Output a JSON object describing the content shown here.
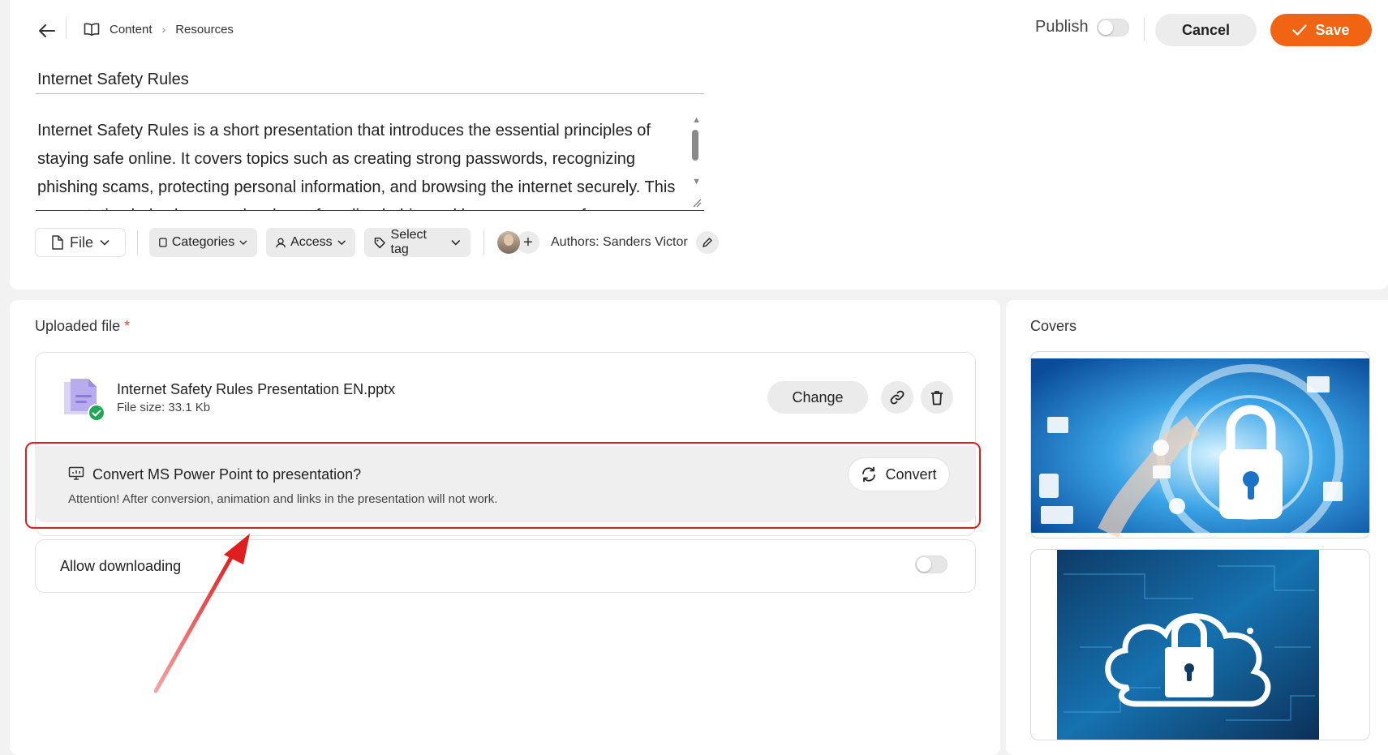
{
  "breadcrumb": {
    "items": [
      "Content",
      "Resources"
    ]
  },
  "header": {
    "publish_label": "Publish",
    "publish_on": false,
    "cancel_label": "Cancel",
    "save_label": "Save"
  },
  "resource": {
    "title": "Internet Safety Rules",
    "description": "Internet Safety Rules is a short presentation that introduces the essential principles of staying safe online. It covers topics such as creating strong passwords, recognizing phishing scams, protecting personal information, and browsing the internet securely. This presentation helps learners develop safe online habits and become aware of common risks."
  },
  "toolbar": {
    "file_label": "File",
    "categories_label": "Categories",
    "access_label": "Access",
    "tag_label": "Select tag",
    "authors_label": "Authors: Sanders Victor"
  },
  "upload": {
    "section_label": "Uploaded file",
    "required_mark": "*",
    "file_name": "Internet Safety Rules Presentation EN.pptx",
    "file_size": "File size: 33.1 Kb",
    "change_label": "Change"
  },
  "convert": {
    "title": "Convert MS Power Point to presentation?",
    "note": "Attention! After conversion, animation and links in the presentation will not work.",
    "button_label": "Convert"
  },
  "allow_download": {
    "label": "Allow downloading",
    "enabled": false
  },
  "covers": {
    "label": "Covers",
    "items": [
      "padlock-network-cover",
      "cloud-lock-cover"
    ]
  },
  "colors": {
    "accent": "#f06414",
    "highlight": "#e01e1e",
    "success": "#1fa855"
  }
}
